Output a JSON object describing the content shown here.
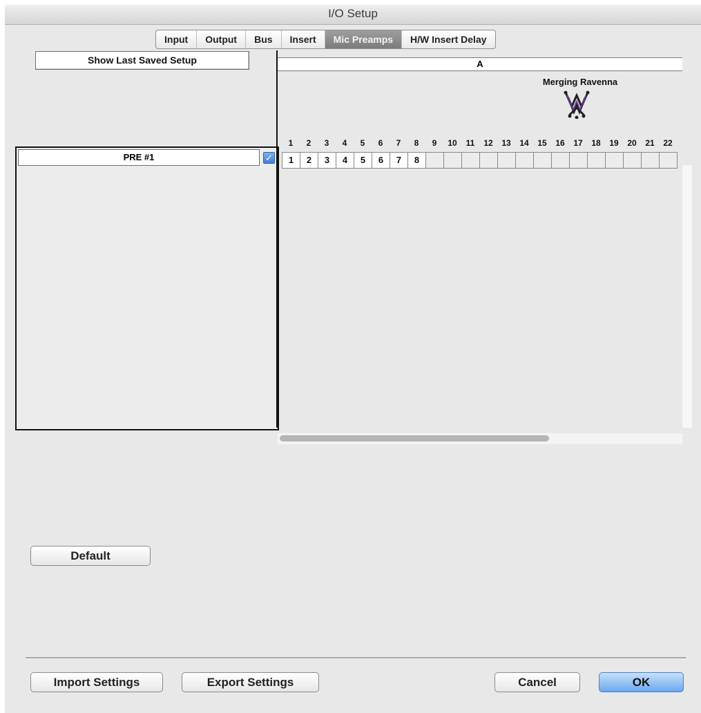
{
  "window": {
    "title": "I/O Setup"
  },
  "tabs": [
    {
      "label": "Input",
      "active": false
    },
    {
      "label": "Output",
      "active": false
    },
    {
      "label": "Bus",
      "active": false
    },
    {
      "label": "Insert",
      "active": false
    },
    {
      "label": "Mic Preamps",
      "active": true
    },
    {
      "label": "H/W Insert Delay",
      "active": false
    }
  ],
  "show_last_saved_label": "Show Last Saved Setup",
  "column_header": "A",
  "device": {
    "name": "Merging Ravenna",
    "icon": "merging-ravenna-logo"
  },
  "channel_numbers": [
    "1",
    "2",
    "3",
    "4",
    "5",
    "6",
    "7",
    "8",
    "9",
    "10",
    "11",
    "12",
    "13",
    "14",
    "15",
    "16",
    "17",
    "18",
    "19",
    "20",
    "21",
    "22"
  ],
  "row": {
    "label": "PRE #1",
    "checked": true,
    "assigned": [
      "1",
      "2",
      "3",
      "4",
      "5",
      "6",
      "7",
      "8"
    ]
  },
  "buttons": {
    "default": "Default",
    "import": "Import Settings",
    "export": "Export Settings",
    "cancel": "Cancel",
    "ok": "OK"
  },
  "colors": {
    "active_tab": "#8a8a8a",
    "ok_button": "#6aa8ef",
    "checkbox": "#3f7fd4"
  }
}
